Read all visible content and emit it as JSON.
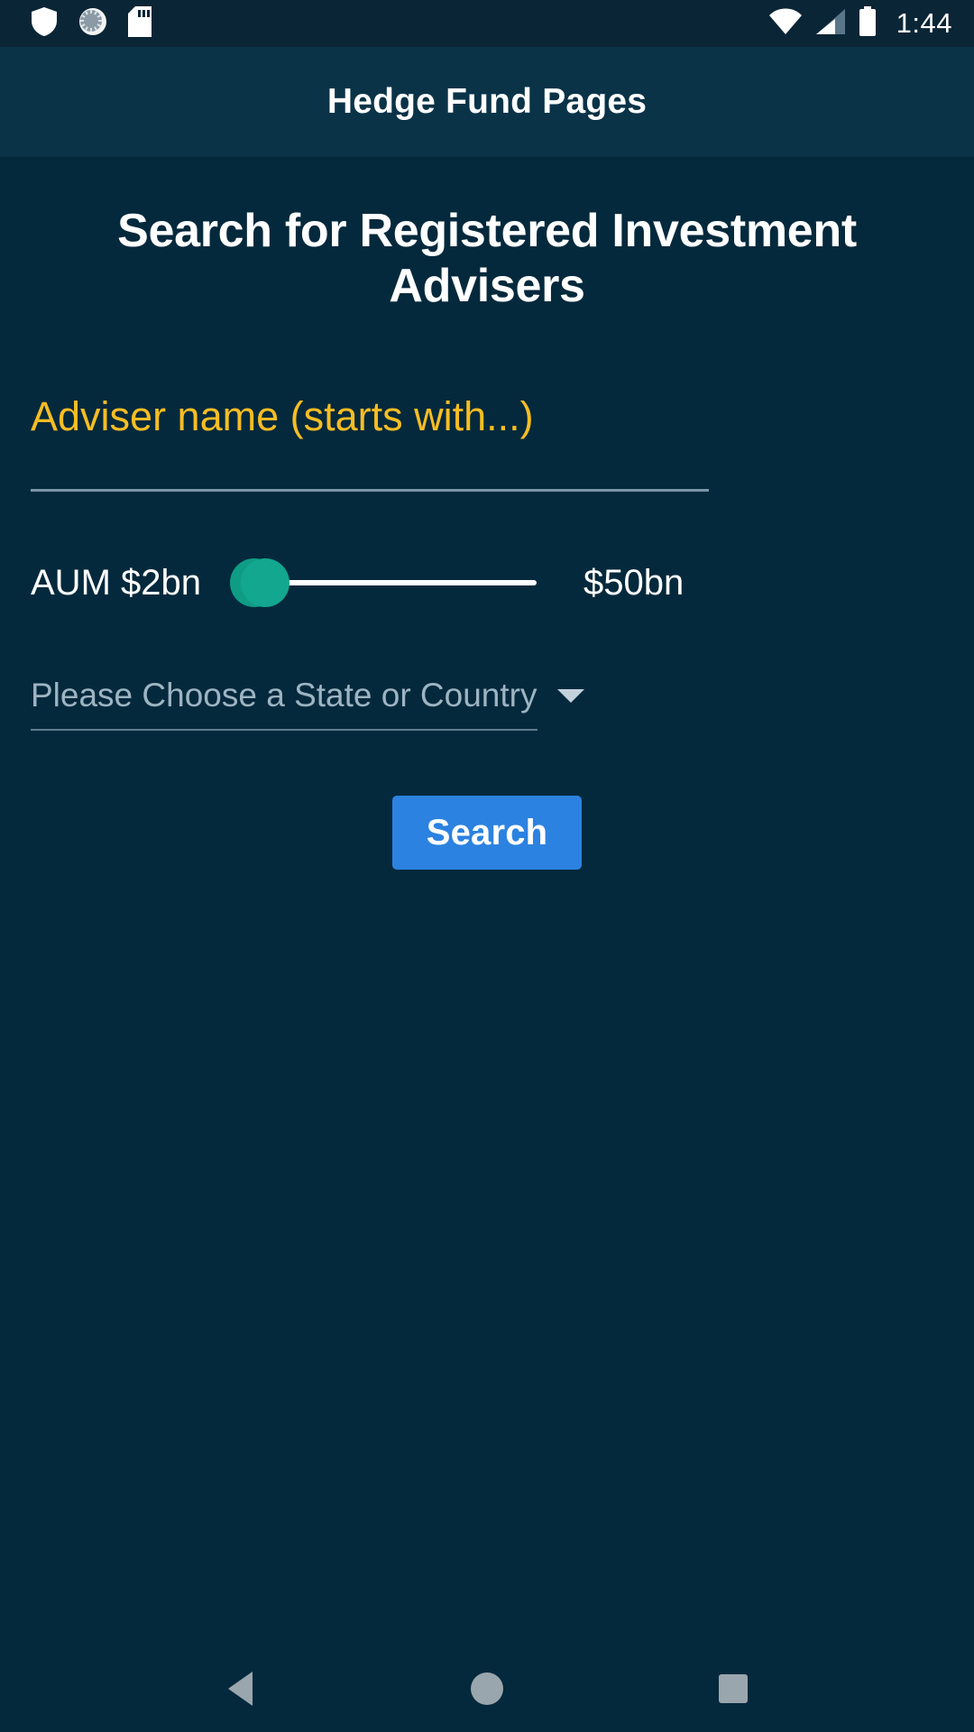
{
  "status_bar": {
    "icons_left": [
      "shield-icon",
      "sync-spinner-icon",
      "sd-card-icon"
    ],
    "icons_right": [
      "wifi-icon",
      "cellular-signal-icon",
      "battery-icon"
    ],
    "time": "1:44"
  },
  "app_bar": {
    "title": "Hedge Fund Pages"
  },
  "main": {
    "page_title": "Search for Registered Investment Advisers",
    "adviser_name_field": {
      "value": "",
      "placeholder": "Adviser name (starts with...)"
    },
    "aum_slider": {
      "min_label": "AUM $2bn",
      "max_label": "$50bn",
      "value": 2,
      "min": 2,
      "max": 50,
      "thumb_color": "#12a78e"
    },
    "state_dropdown": {
      "selected": "Please Choose a State or Country",
      "caret": "chevron-down-icon"
    },
    "search_button": {
      "label": "Search",
      "color": "#2c82e0"
    }
  },
  "nav_bar": {
    "back": "back-triangle-icon",
    "home": "home-circle-icon",
    "recents": "recents-square-icon"
  },
  "theme": {
    "background": "#05293c",
    "app_bar": "#0a3348",
    "status_bar": "#0a2536",
    "accent_yellow": "#f8bd23",
    "accent_teal": "#12a78e",
    "accent_blue": "#2c82e0"
  }
}
